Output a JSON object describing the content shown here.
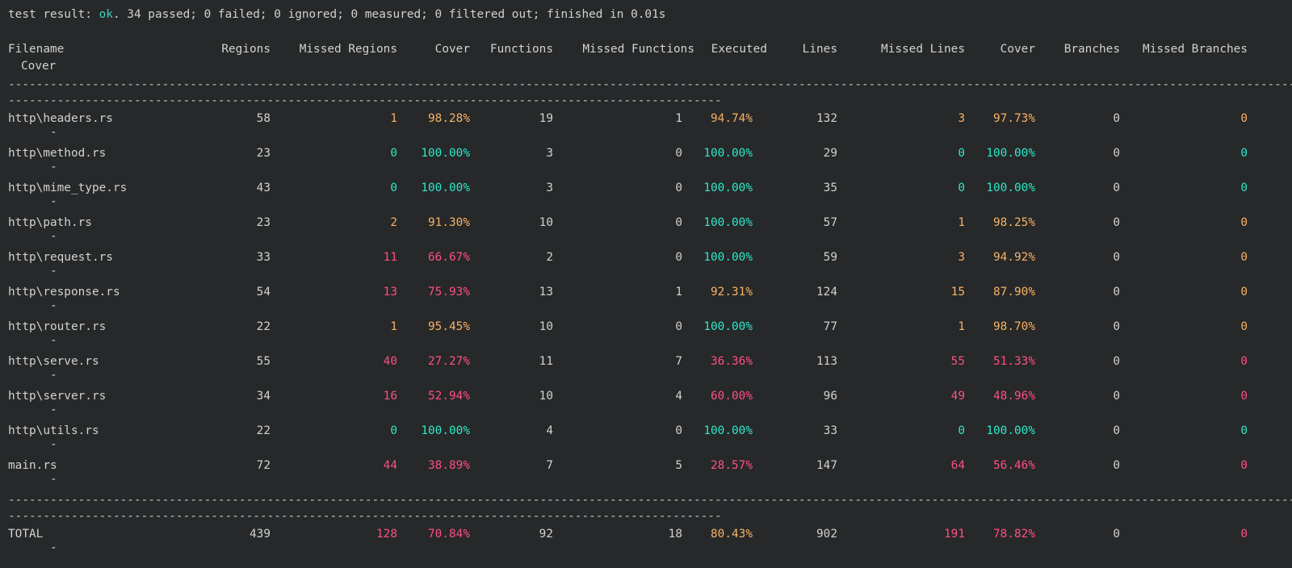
{
  "summary": {
    "prefix": "test result: ",
    "status": "ok",
    "rest": ". 34 passed; 0 failed; 0 ignored; 0 measured; 0 filtered out; finished in 0.01s"
  },
  "colors": {
    "background": "#262829",
    "text": "#d2d2d2",
    "ok": "#3fd3c0",
    "full_coverage": "#2ee8c8",
    "partial_coverage": "#f7b267",
    "low_coverage": "#ff4f86"
  },
  "headers": {
    "filename": "Filename",
    "regions": "Regions",
    "missed_regions": "Missed Regions",
    "region_cover": "Cover",
    "functions": "Functions",
    "missed_functions": "Missed Functions",
    "executed": "Executed",
    "lines": "Lines",
    "missed_lines": "Missed Lines",
    "line_cover": "Cover",
    "branches": "Branches",
    "missed_branches": "Missed Branches",
    "branch_cover": "Cover"
  },
  "separator_char": "-",
  "rows": [
    {
      "file": "http\\headers.rs",
      "regions": "58",
      "missed_regions": "1",
      "region_cover": "98.28%",
      "functions": "19",
      "missed_functions": "1",
      "executed": "94.74%",
      "lines": "132",
      "missed_lines": "3",
      "line_cover": "97.73%",
      "branches": "0",
      "missed_branches": "0",
      "branch_cover": "-",
      "rc": "mid",
      "ec": "mid",
      "lc": "mid",
      "bc": "mid"
    },
    {
      "file": "http\\method.rs",
      "regions": "23",
      "missed_regions": "0",
      "region_cover": "100.00%",
      "functions": "3",
      "missed_functions": "0",
      "executed": "100.00%",
      "lines": "29",
      "missed_lines": "0",
      "line_cover": "100.00%",
      "branches": "0",
      "missed_branches": "0",
      "branch_cover": "-",
      "rc": "full",
      "ec": "full",
      "lc": "full",
      "bc": "full"
    },
    {
      "file": "http\\mime_type.rs",
      "regions": "43",
      "missed_regions": "0",
      "region_cover": "100.00%",
      "functions": "3",
      "missed_functions": "0",
      "executed": "100.00%",
      "lines": "35",
      "missed_lines": "0",
      "line_cover": "100.00%",
      "branches": "0",
      "missed_branches": "0",
      "branch_cover": "-",
      "rc": "full",
      "ec": "full",
      "lc": "full",
      "bc": "full"
    },
    {
      "file": "http\\path.rs",
      "regions": "23",
      "missed_regions": "2",
      "region_cover": "91.30%",
      "functions": "10",
      "missed_functions": "0",
      "executed": "100.00%",
      "lines": "57",
      "missed_lines": "1",
      "line_cover": "98.25%",
      "branches": "0",
      "missed_branches": "0",
      "branch_cover": "-",
      "rc": "mid",
      "ec": "full",
      "lc": "mid",
      "bc": "mid"
    },
    {
      "file": "http\\request.rs",
      "regions": "33",
      "missed_regions": "11",
      "region_cover": "66.67%",
      "functions": "2",
      "missed_functions": "0",
      "executed": "100.00%",
      "lines": "59",
      "missed_lines": "3",
      "line_cover": "94.92%",
      "branches": "0",
      "missed_branches": "0",
      "branch_cover": "-",
      "rc": "low",
      "ec": "full",
      "lc": "mid",
      "bc": "mid"
    },
    {
      "file": "http\\response.rs",
      "regions": "54",
      "missed_regions": "13",
      "region_cover": "75.93%",
      "functions": "13",
      "missed_functions": "1",
      "executed": "92.31%",
      "lines": "124",
      "missed_lines": "15",
      "line_cover": "87.90%",
      "branches": "0",
      "missed_branches": "0",
      "branch_cover": "-",
      "rc": "low",
      "ec": "mid",
      "lc": "mid",
      "bc": "mid"
    },
    {
      "file": "http\\router.rs",
      "regions": "22",
      "missed_regions": "1",
      "region_cover": "95.45%",
      "functions": "10",
      "missed_functions": "0",
      "executed": "100.00%",
      "lines": "77",
      "missed_lines": "1",
      "line_cover": "98.70%",
      "branches": "0",
      "missed_branches": "0",
      "branch_cover": "-",
      "rc": "mid",
      "ec": "full",
      "lc": "mid",
      "bc": "mid"
    },
    {
      "file": "http\\serve.rs",
      "regions": "55",
      "missed_regions": "40",
      "region_cover": "27.27%",
      "functions": "11",
      "missed_functions": "7",
      "executed": "36.36%",
      "lines": "113",
      "missed_lines": "55",
      "line_cover": "51.33%",
      "branches": "0",
      "missed_branches": "0",
      "branch_cover": "-",
      "rc": "low",
      "ec": "low",
      "lc": "low",
      "bc": "low"
    },
    {
      "file": "http\\server.rs",
      "regions": "34",
      "missed_regions": "16",
      "region_cover": "52.94%",
      "functions": "10",
      "missed_functions": "4",
      "executed": "60.00%",
      "lines": "96",
      "missed_lines": "49",
      "line_cover": "48.96%",
      "branches": "0",
      "missed_branches": "0",
      "branch_cover": "-",
      "rc": "low",
      "ec": "low",
      "lc": "low",
      "bc": "low"
    },
    {
      "file": "http\\utils.rs",
      "regions": "22",
      "missed_regions": "0",
      "region_cover": "100.00%",
      "functions": "4",
      "missed_functions": "0",
      "executed": "100.00%",
      "lines": "33",
      "missed_lines": "0",
      "line_cover": "100.00%",
      "branches": "0",
      "missed_branches": "0",
      "branch_cover": "-",
      "rc": "full",
      "ec": "full",
      "lc": "full",
      "bc": "full"
    },
    {
      "file": "main.rs",
      "regions": "72",
      "missed_regions": "44",
      "region_cover": "38.89%",
      "functions": "7",
      "missed_functions": "5",
      "executed": "28.57%",
      "lines": "147",
      "missed_lines": "64",
      "line_cover": "56.46%",
      "branches": "0",
      "missed_branches": "0",
      "branch_cover": "-",
      "rc": "low",
      "ec": "low",
      "lc": "low",
      "bc": "low"
    }
  ],
  "total": {
    "file": "TOTAL",
    "regions": "439",
    "missed_regions": "128",
    "region_cover": "70.84%",
    "functions": "92",
    "missed_functions": "18",
    "executed": "80.43%",
    "lines": "902",
    "missed_lines": "191",
    "line_cover": "78.82%",
    "branches": "0",
    "missed_branches": "0",
    "branch_cover": "-",
    "rc": "low",
    "ec": "mid",
    "lc": "low",
    "bc": "low"
  }
}
